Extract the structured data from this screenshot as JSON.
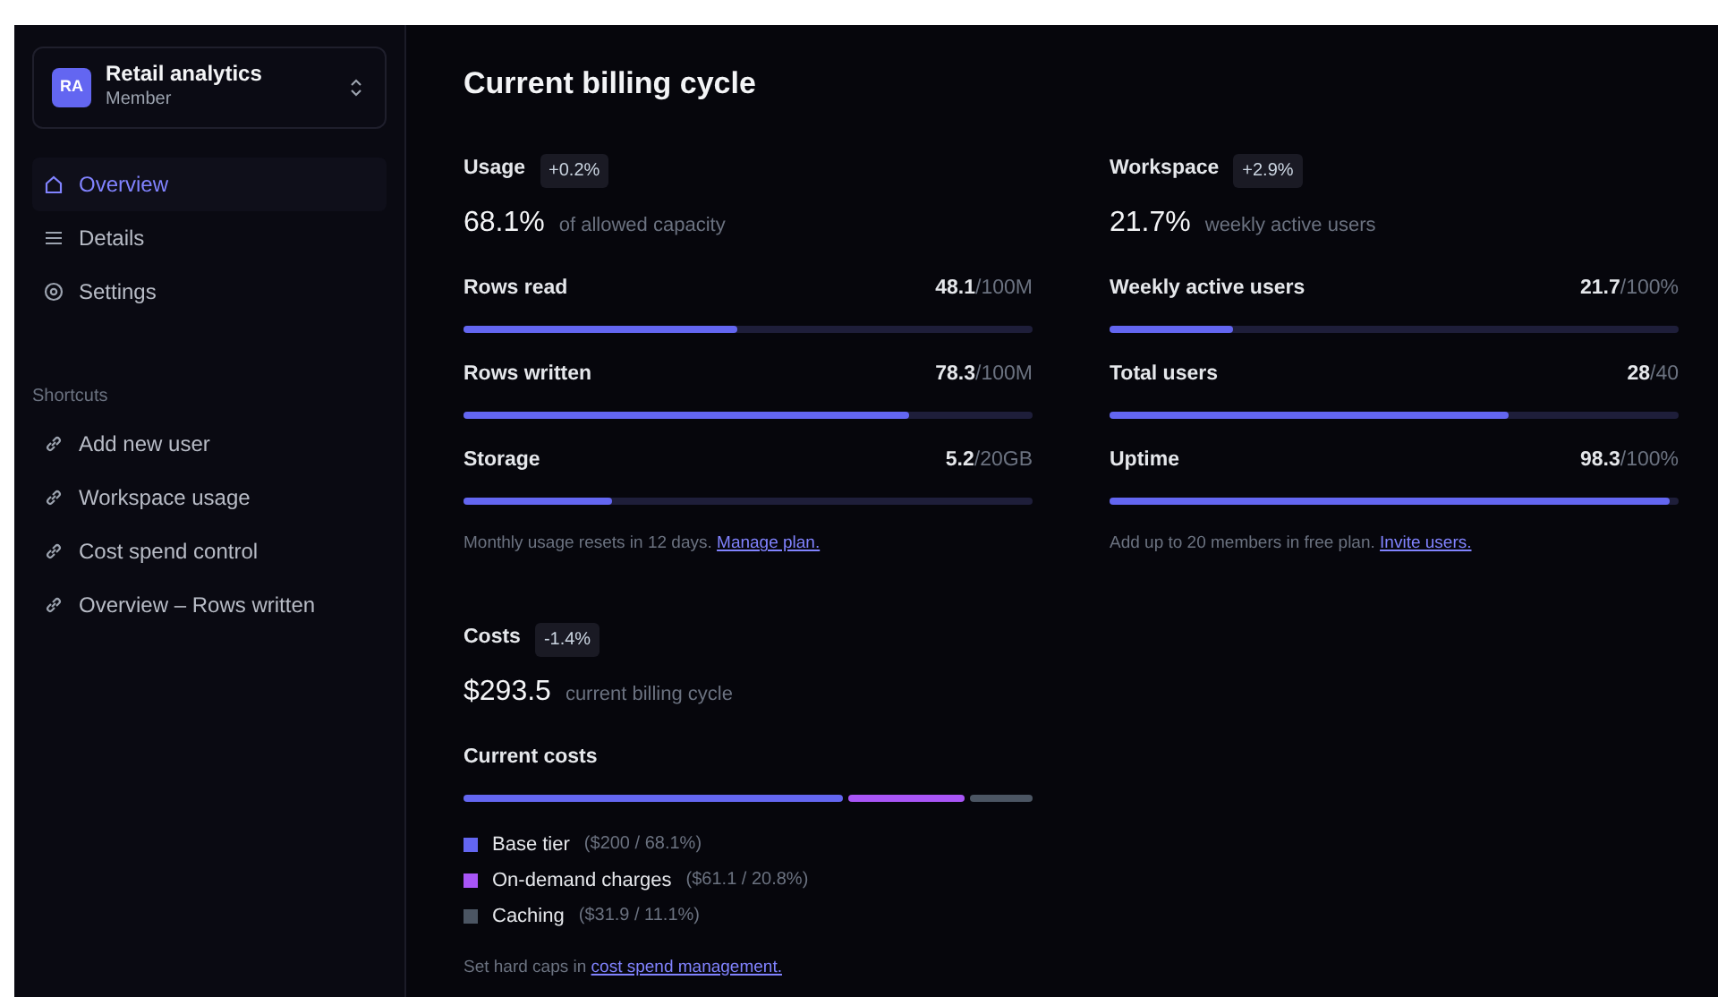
{
  "workspace": {
    "avatar": "RA",
    "name": "Retail analytics",
    "role": "Member"
  },
  "nav": [
    {
      "label": "Overview",
      "selected": true
    },
    {
      "label": "Details",
      "selected": false
    },
    {
      "label": "Settings",
      "selected": false
    }
  ],
  "shortcuts": {
    "heading": "Shortcuts",
    "items": [
      {
        "label": "Add new user"
      },
      {
        "label": "Workspace usage"
      },
      {
        "label": "Cost spend control"
      },
      {
        "label": "Overview – Rows written"
      }
    ]
  },
  "title": "Current billing cycle",
  "sections": [
    {
      "title": "Usage",
      "change": "+0.2%",
      "value": "68.1%",
      "caption": "of allowed capacity",
      "metrics": [
        {
          "label": "Rows read",
          "value": "48.1",
          "total": "/100M",
          "level": 0.481
        },
        {
          "label": "Rows written",
          "value": "78.3",
          "total": "/100M",
          "level": 0.783
        },
        {
          "label": "Storage",
          "value": "5.2",
          "total": "/20GB",
          "level": 0.26
        }
      ],
      "note": "Monthly usage resets in 12 days.",
      "link": "Manage plan."
    },
    {
      "title": "Workspace",
      "change": "+2.9%",
      "value": "21.7%",
      "caption": "weekly active users",
      "metrics": [
        {
          "label": "Weekly active users",
          "value": "21.7",
          "total": "/100%",
          "level": 0.217
        },
        {
          "label": "Total users",
          "value": "28",
          "total": "/40",
          "level": 0.7
        },
        {
          "label": "Uptime",
          "value": "98.3",
          "total": "/100%",
          "level": 0.983
        }
      ],
      "note": "Add up to 20 members in free plan.",
      "link": "Invite users."
    }
  ],
  "costs": {
    "title": "Costs",
    "change": "-1.4%",
    "value": "$293.5",
    "caption": "current billing cycle",
    "subtitle": "Current costs",
    "items": [
      {
        "label": "Base tier",
        "detail": "($200 / 68.1%)",
        "color": "#6366f1"
      },
      {
        "label": "On-demand charges",
        "detail": "($61.1 / 20.8%)",
        "color": "#a855f7"
      },
      {
        "label": "Caching",
        "detail": "($31.9 / 11.1%)",
        "color": "#4b5563"
      }
    ],
    "note": "Set hard caps in",
    "link": "cost spend management."
  }
}
